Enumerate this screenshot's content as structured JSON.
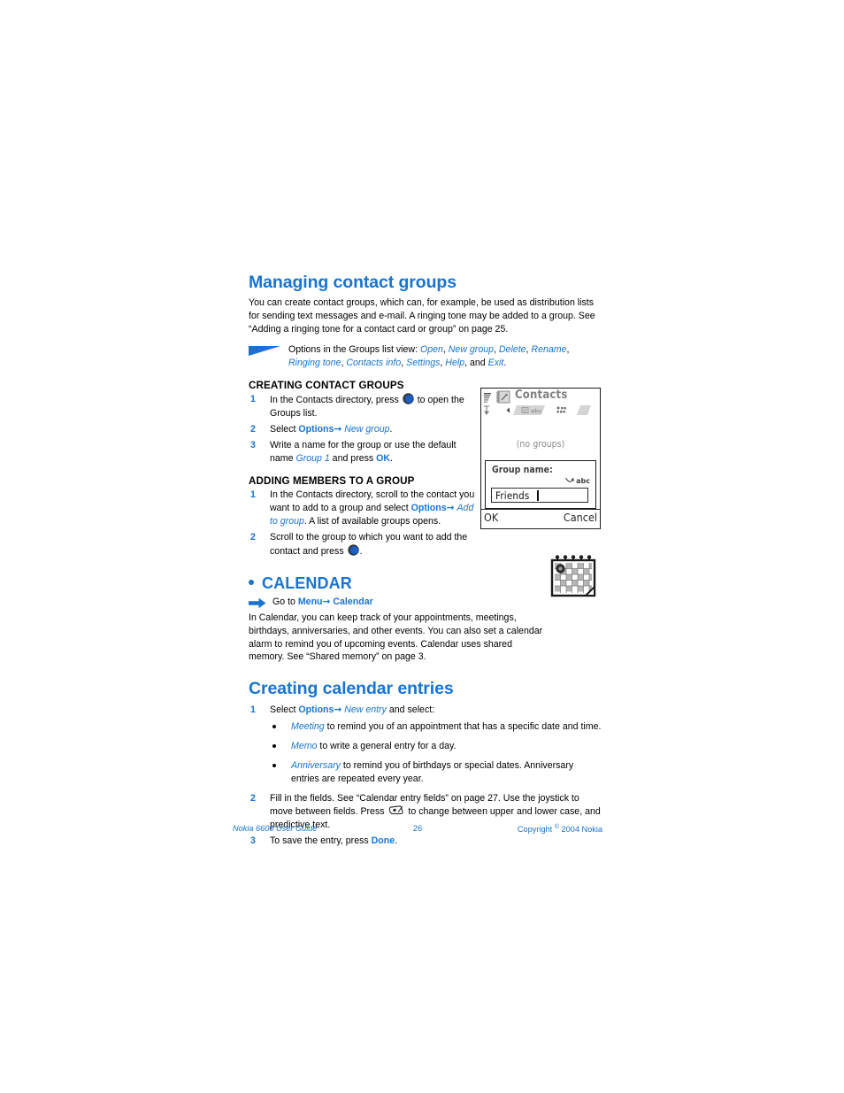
{
  "document": {
    "footer": {
      "left": "Nokia 6600 User Guide",
      "page_number": "26",
      "copyright_prefix": "Copyright",
      "copyright_symbol": "©",
      "copyright_suffix": "2004 Nokia"
    }
  },
  "colors": {
    "accent_blue": "#1874d0",
    "body_text": "#000000",
    "screen_gray": "#808080"
  },
  "sections": {
    "managing_contact_groups": {
      "heading": "Managing contact groups",
      "paragraph": "You can create contact groups, which can, for example, be used as distribution lists for sending text messages and e-mail. A ringing tone may be added to a group. See “Adding a ringing tone for a contact card or group” on page 25.",
      "note": {
        "lead": "Options in the Groups list view: ",
        "options": [
          "Open",
          "New group",
          "Delete",
          "Rename",
          "Ringing tone",
          "Contacts info",
          "Settings",
          "Help"
        ],
        "conjunction": "and",
        "last_option": "Exit",
        "terminator": "."
      }
    },
    "creating_contact_groups": {
      "heading": "CREATING CONTACT GROUPS",
      "steps": [
        {
          "num": "1",
          "part1": "In the Contacts directory, press ",
          "icon": "joystick-icon",
          "part2": " to open the Groups list."
        },
        {
          "num": "2",
          "part1": "Select ",
          "bold_blue": "Options",
          "arrow": "→",
          "italic_blue": "New group",
          "part2": "."
        },
        {
          "num": "3",
          "part1": "Write a name for the group or use the default name ",
          "italic_blue": "Group 1",
          "part2": " and press ",
          "bold_blue": "OK",
          "part3": "."
        }
      ]
    },
    "adding_members": {
      "heading": "ADDING MEMBERS TO A GROUP",
      "steps": [
        {
          "num": "1",
          "part1": "In the Contacts directory, scroll to the contact you want to add to a group and select ",
          "bold_blue": "Options",
          "arrow": "→",
          "italic_blue": "Add to group",
          "part2": ". A list of available groups opens."
        },
        {
          "num": "2",
          "part1": "Scroll to the group to which you want to add the contact and press ",
          "icon": "joystick-icon",
          "part2": "."
        }
      ]
    },
    "calendar": {
      "heading": "CALENDAR",
      "goto": {
        "lead": "Go to ",
        "menu": "Menu",
        "arrow": "→",
        "target": "Calendar"
      },
      "paragraph": "In Calendar, you can keep track of your appointments, meetings, birthdays, anniversaries, and other events. You can also set a calendar alarm to remind you of upcoming events. Calendar uses shared memory. See “Shared memory” on page 3.",
      "illustration_name": "calendar-illustration"
    },
    "creating_calendar_entries": {
      "heading": "Creating calendar entries",
      "steps": [
        {
          "num": "1",
          "part1": "Select ",
          "bold_blue": "Options",
          "arrow": "→",
          "italic_blue": "New entry",
          "part2": " and select:"
        },
        {
          "num": "2",
          "part1": "Fill in the fields. See “Calendar entry fields” on page 27. Use the joystick to move between fields. Press ",
          "icon": "pencil-key-icon",
          "part2": " to change between upper and lower case, and predictive text."
        },
        {
          "num": "3",
          "part1": "To save the entry, press ",
          "bold_blue": "Done",
          "part2": "."
        }
      ],
      "bullets": [
        {
          "italic_blue": "Meeting",
          "text": " to remind you of an appointment that has a specific date and time."
        },
        {
          "italic_blue": "Memo",
          "text": " to write a general entry for a day."
        },
        {
          "italic_blue": "Anniversary",
          "text": " to remind you of birthdays or special dates. Anniversary entries are repeated every year."
        }
      ]
    }
  },
  "phone_screen": {
    "title": "Contacts",
    "app_icon": "contacts-book-icon",
    "signal_icon": "signal-bars-icon",
    "antenna_icon": "antenna-icon",
    "tabs": [
      {
        "name": "contacts-list-tab",
        "label": "abc",
        "active": false
      },
      {
        "name": "contacts-groups-tab",
        "label": "",
        "active": true
      }
    ],
    "list_empty_text": "(no groups)",
    "dialog": {
      "label": "Group name:",
      "input_mode": "abc",
      "input_mode_icon": "pen-mode-icon",
      "input_value": "Friends",
      "input_placeholder": ""
    },
    "softkeys": {
      "left": "OK",
      "right": "Cancel"
    }
  }
}
